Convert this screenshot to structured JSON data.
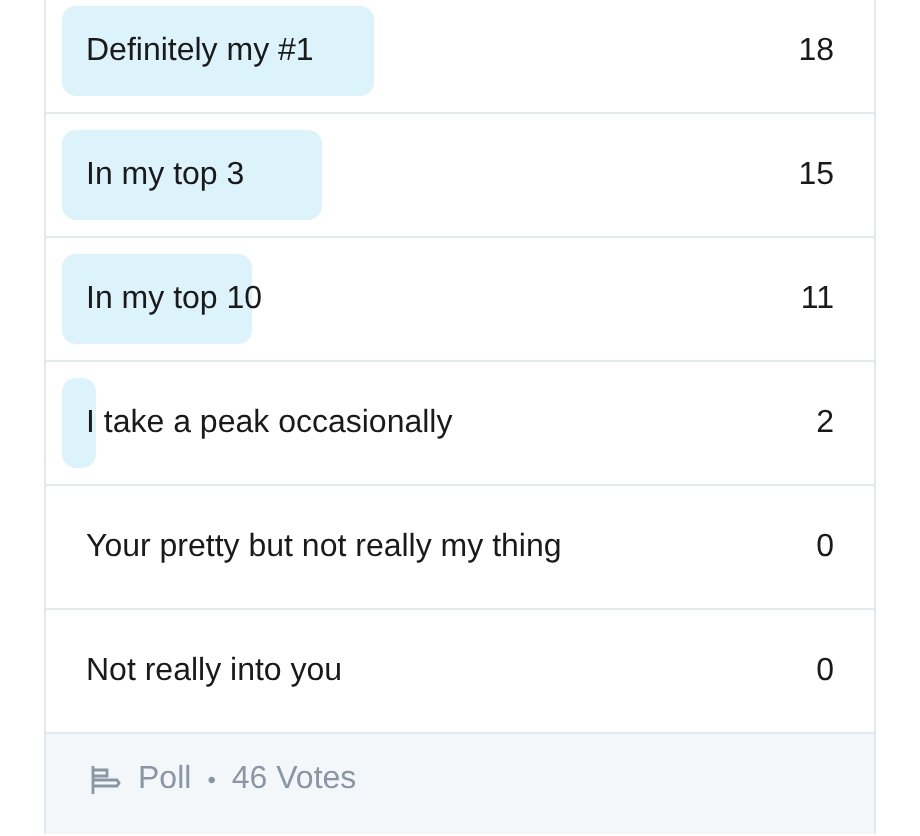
{
  "poll": {
    "options": [
      {
        "label": "Definitely my #1",
        "count": "18"
      },
      {
        "label": "In my top 3",
        "count": "15"
      },
      {
        "label": "In my top 10",
        "count": "11"
      },
      {
        "label": "I take a peak occasionally",
        "count": "2"
      },
      {
        "label": "Your pretty but not really my thing",
        "count": "0"
      },
      {
        "label": "Not really into you",
        "count": "0"
      }
    ],
    "footer": {
      "type": "Poll",
      "separator": "•",
      "votes": "46 Votes"
    }
  }
}
